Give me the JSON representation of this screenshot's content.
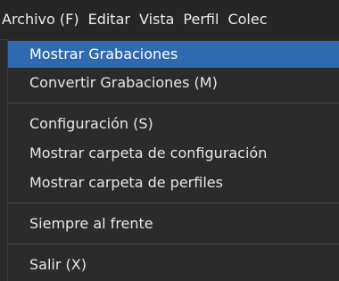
{
  "menubar": {
    "items": [
      {
        "label": "Archivo (F)"
      },
      {
        "label": "Editar"
      },
      {
        "label": "Vista"
      },
      {
        "label": "Perfil"
      },
      {
        "label": "Colec"
      }
    ]
  },
  "menu": {
    "items": [
      {
        "label": "Mostrar Grabaciones",
        "highlighted": true
      },
      {
        "label": "Convertir Grabaciones (M)"
      },
      {
        "label": "Configuración (S)"
      },
      {
        "label": "Mostrar carpeta de configuración"
      },
      {
        "label": "Mostrar carpeta de perfiles"
      },
      {
        "label": "Siempre al frente"
      },
      {
        "label": "Salir (X)"
      }
    ]
  },
  "colors": {
    "highlight": "#2f69b0",
    "background": "#2b2b2b",
    "text": "#e6e6e6"
  }
}
